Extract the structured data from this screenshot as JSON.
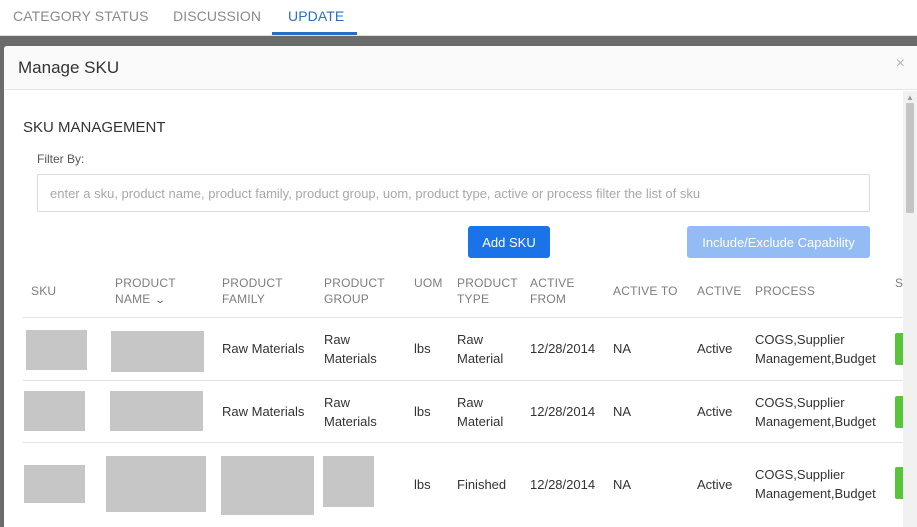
{
  "tabs": [
    {
      "label": "CATEGORY STATUS"
    },
    {
      "label": "DISCUSSION"
    },
    {
      "label": "UPDATE"
    }
  ],
  "active_tab": "UPDATE",
  "modal": {
    "title": "Manage SKU",
    "close_icon": "×"
  },
  "section_title": "SKU MANAGEMENT",
  "filter": {
    "label": "Filter By:",
    "value": "",
    "placeholder": "enter a sku, product name, product family, product group, uom, product type, active or process filter the list of sku"
  },
  "buttons": {
    "add_sku": "Add SKU",
    "include_exclude": "Include/Exclude Capability"
  },
  "columns": {
    "sku": "SKU",
    "product_name_1": "PRODUCT",
    "product_name_2": "NAME",
    "product_family_1": "PRODUCT",
    "product_family_2": "FAMILY",
    "product_group_1": "PRODUCT",
    "product_group_2": "GROUP",
    "uom": "UOM",
    "product_type_1": "PRODUCT",
    "product_type_2": "TYPE",
    "active_from_1": "ACTIVE",
    "active_from_2": "FROM",
    "active_to": "ACTIVE TO",
    "active": "ACTIVE",
    "process": "PROCESS",
    "status_partial": "S"
  },
  "rows": [
    {
      "product_family": "Raw Materials",
      "product_group_1": "Raw",
      "product_group_2": "Materials",
      "uom": "lbs",
      "product_type_1": "Raw",
      "product_type_2": "Material",
      "active_from": "12/28/2014",
      "active_to": "NA",
      "active": "Active",
      "process_1": "COGS,Supplier",
      "process_2": "Management,Budget"
    },
    {
      "product_family": "Raw Materials",
      "product_group_1": "Raw",
      "product_group_2": "Materials",
      "uom": "lbs",
      "product_type_1": "Raw",
      "product_type_2": "Material",
      "active_from": "12/28/2014",
      "active_to": "NA",
      "active": "Active",
      "process_1": "COGS,Supplier",
      "process_2": "Management,Budget"
    },
    {
      "uom": "lbs",
      "product_type_1": "Finished",
      "active_from": "12/28/2014",
      "active_to": "NA",
      "active": "Active",
      "process_1": "COGS,Supplier",
      "process_2": "Management,Budget"
    }
  ],
  "icons": {
    "sort": "chevron-down-icon",
    "close": "close-icon",
    "scroll_up": "arrow-up-icon"
  },
  "colors": {
    "accent": "#2c6cc4",
    "primary_button": "#1a73e8",
    "disabled_button": "#93bcf4",
    "status_green": "#58c43a"
  }
}
